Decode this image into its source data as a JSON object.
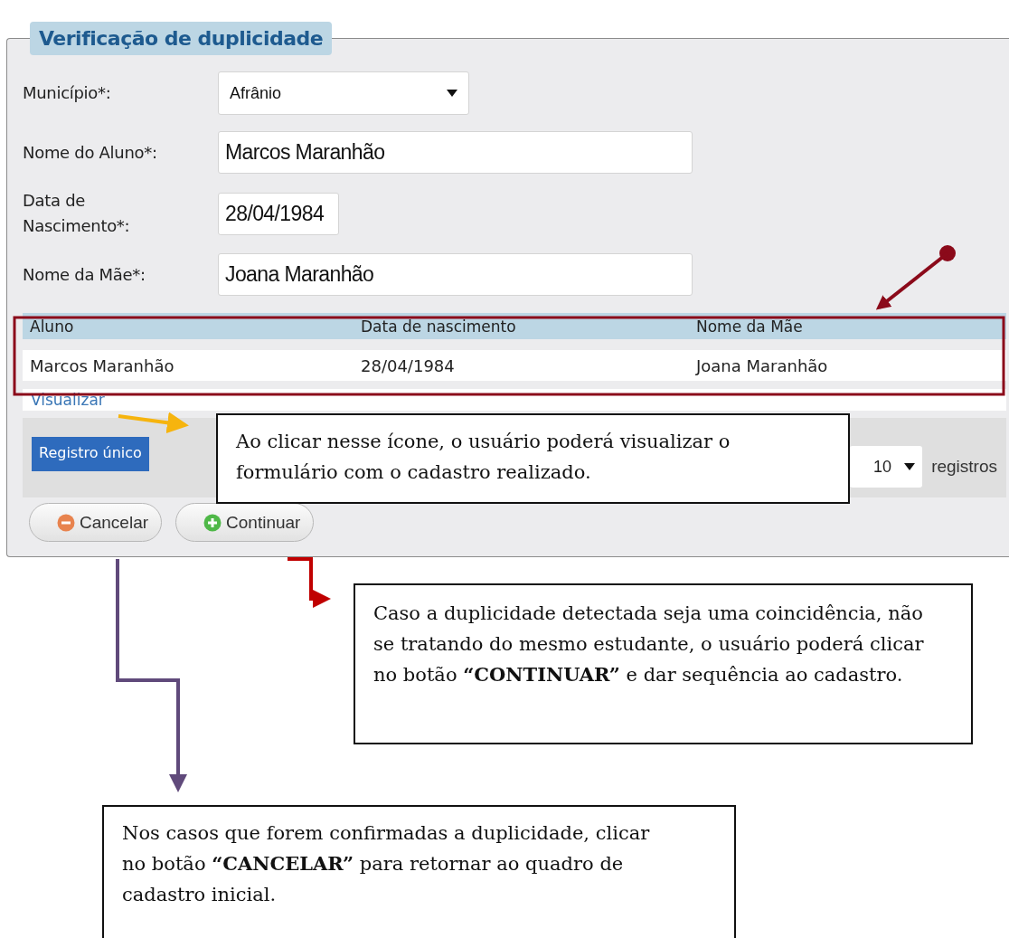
{
  "form": {
    "legend": "Verificação de duplicidade",
    "fields": [
      {
        "kind": "select",
        "label": "Município*:",
        "value": "Afrânio"
      },
      {
        "kind": "text",
        "label": "Nome do Aluno*:",
        "value": "Marcos Maranhão"
      },
      {
        "kind": "date",
        "label": "Data de Nascimento*:",
        "value": "28/04/1984"
      },
      {
        "kind": "text",
        "label": "Nome da Mãe*:",
        "value": "Joana Maranhão"
      }
    ],
    "table": {
      "columns": [
        "Aluno",
        "Data de nascimento",
        "Nome da Mãe"
      ],
      "rows": [
        [
          "Marcos Maranhão",
          "28/04/1984",
          "Joana Maranhão"
        ]
      ]
    },
    "view_link": "Visualizar",
    "toolbar": {
      "button": "Registro único",
      "page_size": "10",
      "page_size_suffix": "registros"
    },
    "buttons": [
      {
        "kind": "cancel",
        "label": "Cancelar"
      },
      {
        "kind": "continue",
        "label": "Continuar"
      }
    ]
  },
  "callouts": [
    {
      "text": "Ao clicar nesse ícone, o usuário poderá visualizar o formulário com o cadastro realizado."
    },
    {
      "text": "Caso a duplicidade detectada seja uma coincidência, não se tratando do mesmo estudante, o usuário poderá clicar no botão **“CONTINUAR”** e dar sequência ao cadastro."
    },
    {
      "text": "Nos casos que forem confirmadas a duplicidade, clicar no botão **“CANCELAR”** para retornar ao quadro de cadastro inicial."
    }
  ]
}
